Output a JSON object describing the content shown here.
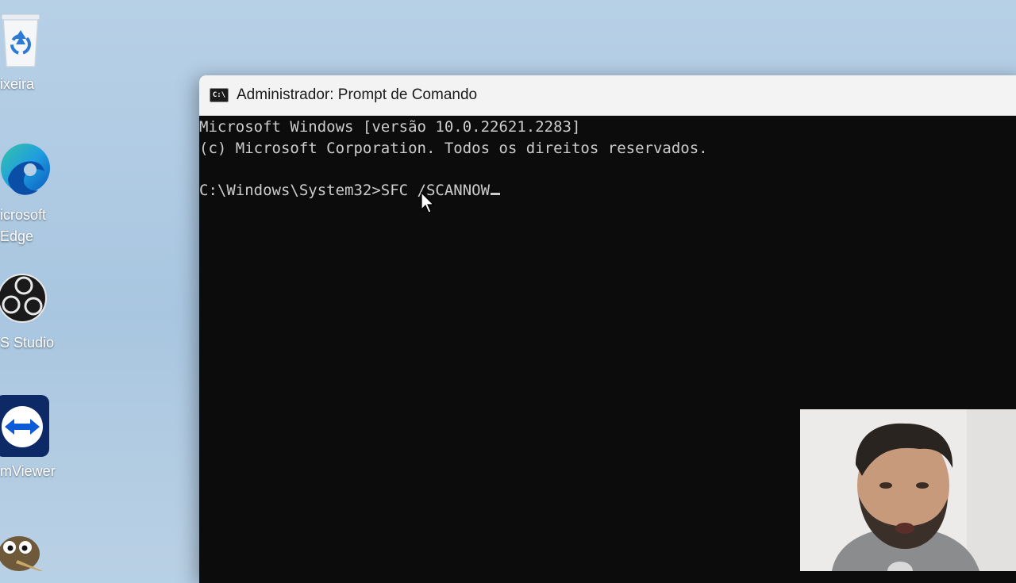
{
  "desktop": {
    "icons": [
      {
        "label": "ixeira",
        "icon": "recycle-bin-icon"
      },
      {
        "label": "icrosoft\nEdge",
        "icon": "edge-icon"
      },
      {
        "label": "S Studio",
        "icon": "obs-icon"
      },
      {
        "label": "mViewer",
        "icon": "teamviewer-icon"
      },
      {
        "label": "",
        "icon": "gimp-icon"
      }
    ]
  },
  "window": {
    "title": "Administrador: Prompt de Comando",
    "icon": "cmd-icon",
    "app_icon_text": "C:\\"
  },
  "console": {
    "lines": [
      "Microsoft Windows [versão 10.0.22621.2283]",
      "(c) Microsoft Corporation. Todos os direitos reservados.",
      "",
      "C:\\Windows\\System32>SFC /SCANNOW"
    ]
  },
  "colors": {
    "console_bg": "#0c0c0c",
    "console_fg": "#cccccc",
    "titlebar_bg": "#f3f3f3"
  },
  "overlay": {
    "webcam": "presenter-webcam"
  }
}
